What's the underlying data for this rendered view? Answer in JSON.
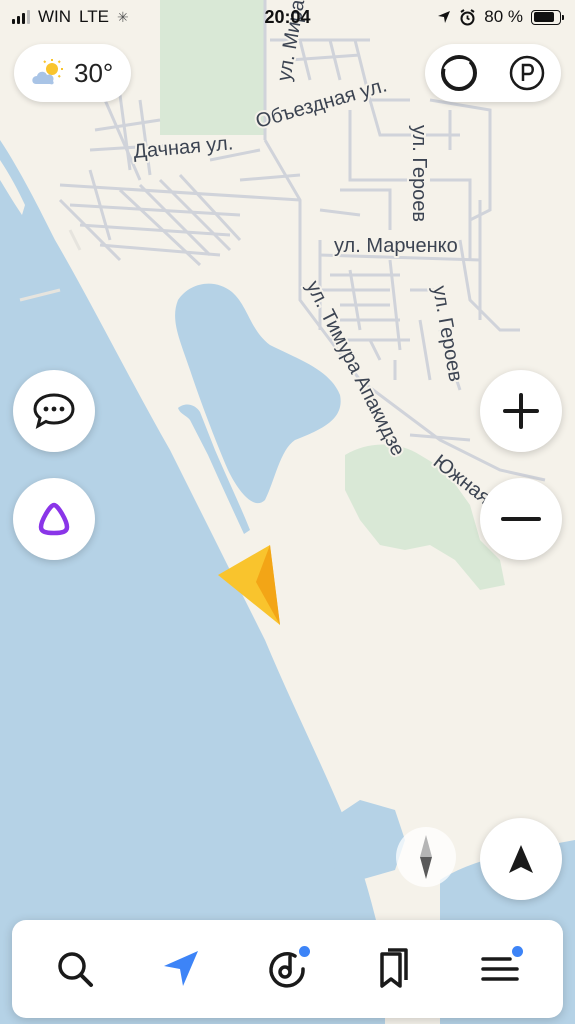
{
  "status_bar": {
    "carrier": "WIN",
    "network": "LTE",
    "time": "20:04",
    "battery_percent": "80 %",
    "battery_level": 0.8
  },
  "weather": {
    "temperature": "30°",
    "icon": "partly-sunny-icon"
  },
  "top_right": {
    "icons": [
      "alice-profile-icon",
      "parking-icon"
    ]
  },
  "map": {
    "water_color": "#b5d2e6",
    "land_color": "#f5f2ea",
    "park_color": "#d9e8d6",
    "street_labels": {
      "mira": "ул. Мира",
      "obezdnaya": "Объездная ул.",
      "dachnaya": "Дачная ул.",
      "geroev_1": "ул. Героев",
      "marchenko": "ул. Марченко",
      "geroev_2": "ул. Героев",
      "timura": "ул. Тимура Апакидзе",
      "yuzhnaya": "Южная"
    }
  },
  "controls": {
    "chat_icon": "chat-bubble-icon",
    "alice_icon": "alice-assistant-icon",
    "zoom_in_icon": "plus-icon",
    "zoom_out_icon": "minus-icon",
    "locate_icon": "navigation-arrow-icon",
    "compass_icon": "compass-icon"
  },
  "bottom_nav": {
    "items": [
      "search-icon",
      "navigator-icon",
      "music-icon",
      "bookmarks-icon",
      "menu-icon"
    ],
    "accent": "#3d84f7"
  }
}
